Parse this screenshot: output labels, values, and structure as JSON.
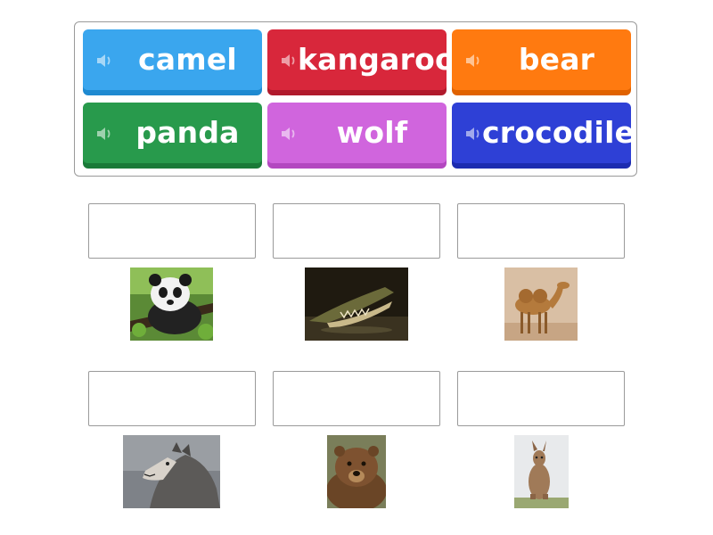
{
  "tiles": [
    {
      "label": "camel",
      "color": "#3aa6ee",
      "shade": "#1f8ad1"
    },
    {
      "label": "kangaroo",
      "color": "#d8273b",
      "shade": "#b01a2c"
    },
    {
      "label": "bear",
      "color": "#ff7a10",
      "shade": "#e06200"
    },
    {
      "label": "panda",
      "color": "#289a4c",
      "shade": "#1a7a38"
    },
    {
      "label": "wolf",
      "color": "#d065dd",
      "shade": "#b347c0"
    },
    {
      "label": "crocodile",
      "color": "#2e40d6",
      "shade": "#1c2cb0"
    }
  ],
  "images": [
    "panda",
    "crocodile",
    "camel",
    "wolf",
    "bear",
    "kangaroo"
  ],
  "icons": {
    "tile_icon": "speaker-icon"
  }
}
